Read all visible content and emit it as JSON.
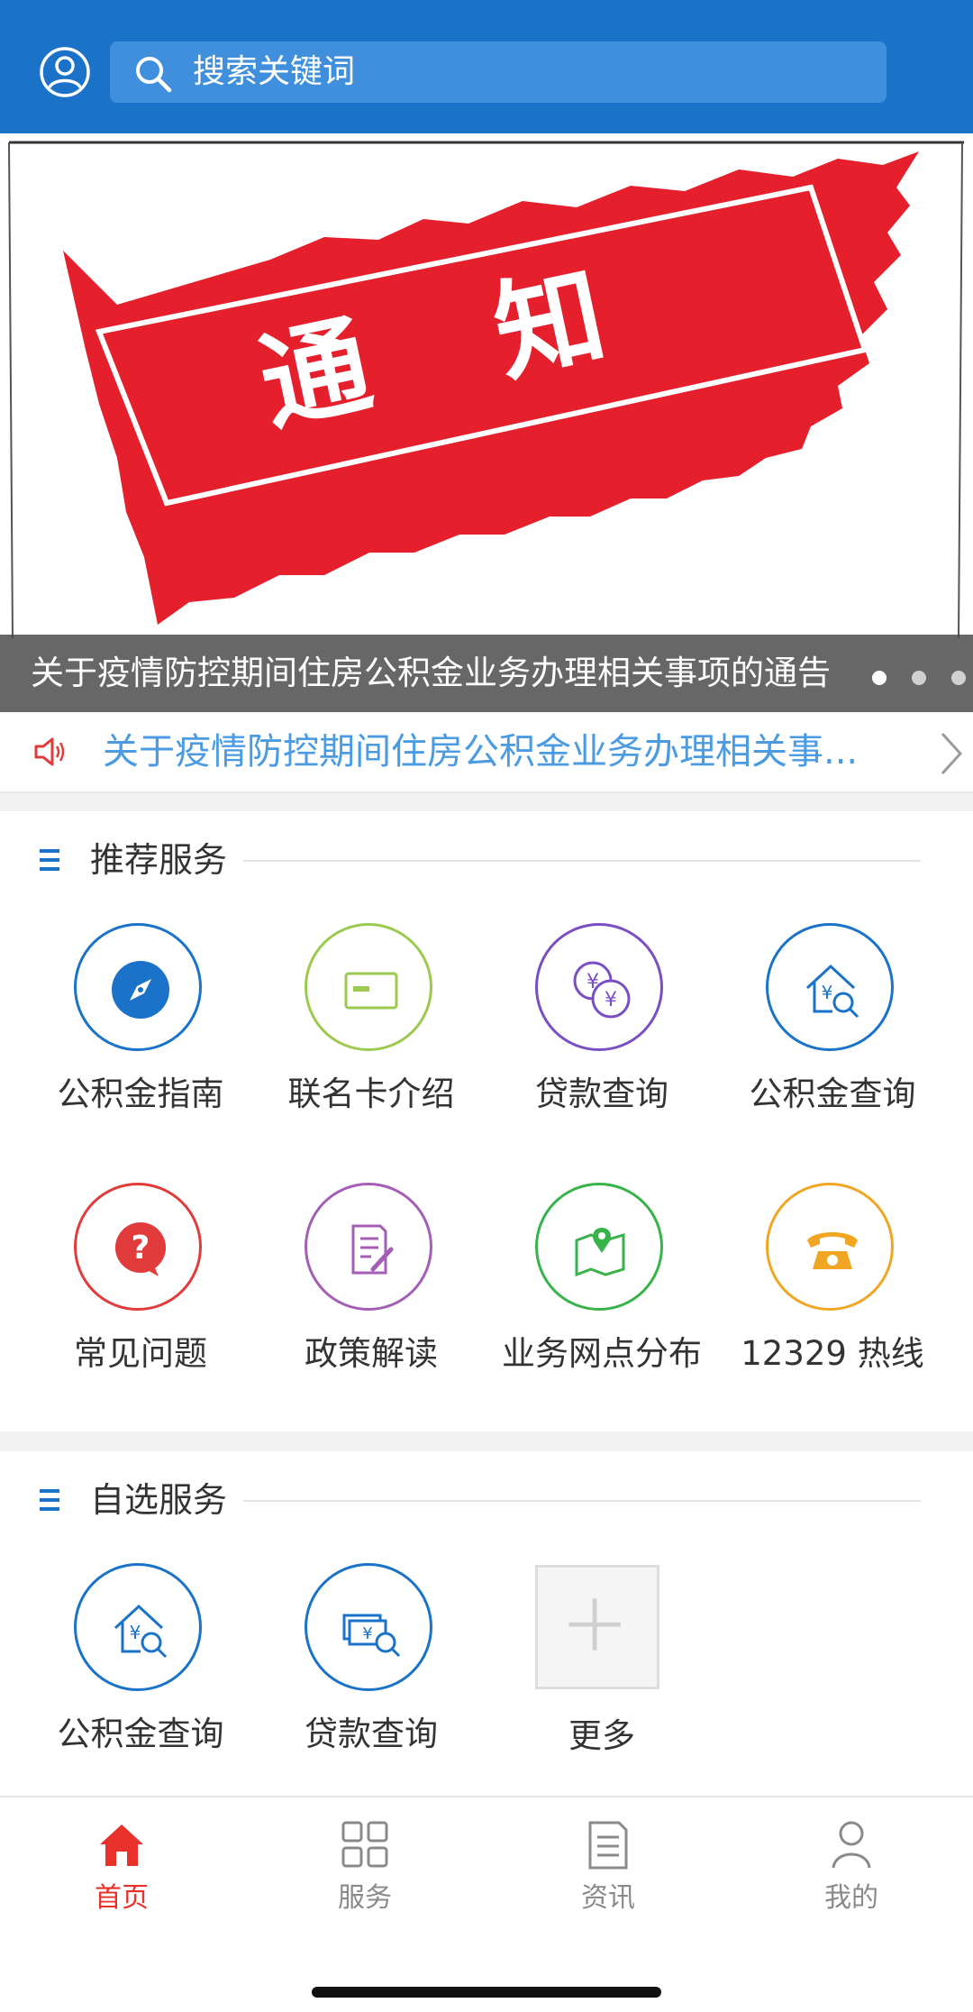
{
  "header": {
    "search_placeholder": "搜索关键词",
    "user_icon": "user-circle-icon",
    "search_icon": "search-icon"
  },
  "banner": {
    "image_text": "通 知",
    "caption": "关于疫情防控期间住房公积金业务办理相关事项的通告",
    "slides": 3,
    "active_slide": 1
  },
  "notice": {
    "icon": "speaker-icon",
    "text": "关于疫情防控期间住房公积金业务办理相关事..."
  },
  "recommended": {
    "title": "推荐服务",
    "items": [
      {
        "label": "公积金指南",
        "icon": "compass-icon",
        "color": "#1a72c9"
      },
      {
        "label": "联名卡介绍",
        "icon": "card-icon",
        "color": "#9cc94f"
      },
      {
        "label": "贷款查询",
        "icon": "coins-icon",
        "color": "#7b4fc4"
      },
      {
        "label": "公积金查询",
        "icon": "house-search-icon",
        "color": "#1a72c9"
      },
      {
        "label": "常见问题",
        "icon": "question-icon",
        "color": "#e23b3b"
      },
      {
        "label": "政策解读",
        "icon": "document-edit-icon",
        "color": "#a55eb5"
      },
      {
        "label": "业务网点分布",
        "icon": "map-pin-icon",
        "color": "#37b34a"
      },
      {
        "label": "12329 热线",
        "icon": "telephone-icon",
        "color": "#f0a623"
      }
    ]
  },
  "custom": {
    "title": "自选服务",
    "items": [
      {
        "label": "公积金查询",
        "icon": "house-search-icon",
        "color": "#1a72c9"
      },
      {
        "label": "贷款查询",
        "icon": "money-search-icon",
        "color": "#1a72c9"
      },
      {
        "label": "更多",
        "icon": "plus-icon",
        "color": "#cccccc"
      }
    ]
  },
  "tabbar": {
    "items": [
      {
        "label": "首页",
        "icon": "home-icon",
        "active": true
      },
      {
        "label": "服务",
        "icon": "grid-icon",
        "active": false
      },
      {
        "label": "资讯",
        "icon": "news-icon",
        "active": false
      },
      {
        "label": "我的",
        "icon": "person-icon",
        "active": false
      }
    ]
  },
  "colors": {
    "header": "#1a72c9",
    "accent": "#e8312a",
    "notice_text": "#4a9be2"
  }
}
